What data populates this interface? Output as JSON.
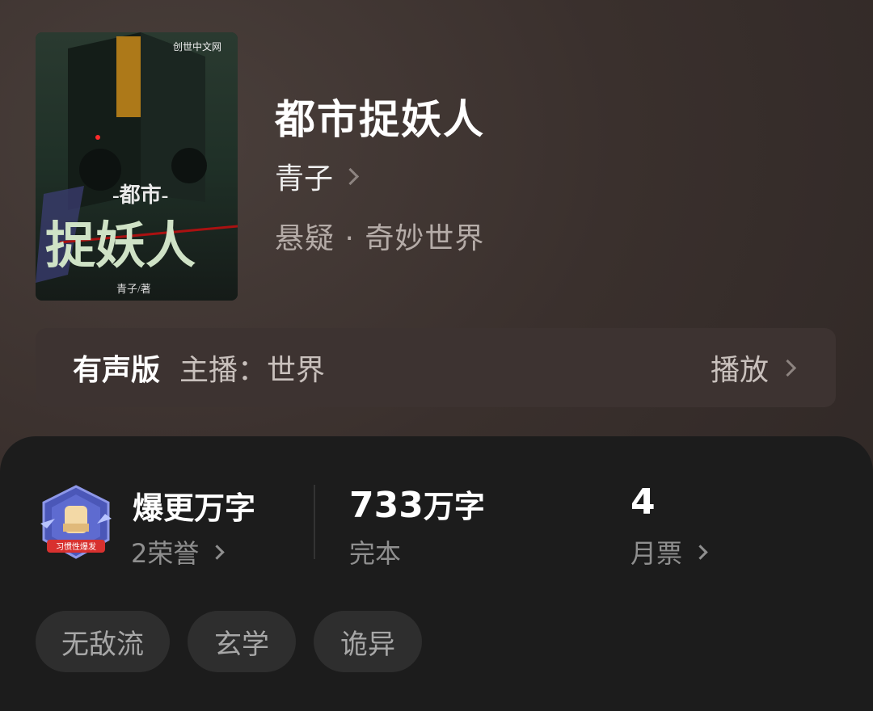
{
  "book": {
    "title": "都市捉妖人",
    "author": "青子",
    "genre": "悬疑 · 奇妙世界",
    "cover_title_small": "-都市-",
    "cover_title_big": "捉妖人",
    "cover_author": "青子/著",
    "cover_publisher": "创世中文网"
  },
  "audio": {
    "label": "有声版",
    "host": "主播：世界",
    "play_label": "播放"
  },
  "stats": {
    "honor_title": "爆更万字",
    "honor_sub": "2荣誉",
    "badge_text": "习惯性爆发",
    "word_count": "733",
    "word_unit": "万字",
    "status": "完本",
    "monthly_votes": "4",
    "monthly_votes_label": "月票"
  },
  "tags": [
    "无敌流",
    "玄学",
    "诡异"
  ]
}
